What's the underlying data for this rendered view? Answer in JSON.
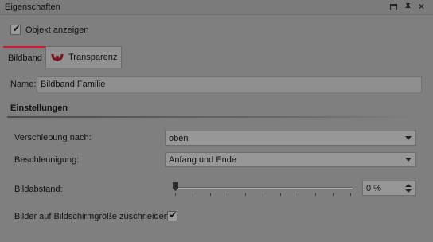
{
  "panel": {
    "title": "Eigenschaften",
    "restore_icon": "restore-window-icon",
    "pin_icon": "pin-icon",
    "close_icon": "close-icon"
  },
  "show_object": {
    "label": "Objekt anzeigen",
    "checked": true
  },
  "tabs": [
    {
      "label": "Bildband",
      "active": true
    },
    {
      "label": "Transparenz",
      "active": false,
      "icon": "transparency-icon"
    }
  ],
  "name": {
    "label": "Name:",
    "value": "Bildband Familie"
  },
  "settings": {
    "title": "Einstellungen",
    "shift": {
      "label": "Verschiebung nach:",
      "value": "oben"
    },
    "acceleration": {
      "label": "Beschleunigung:",
      "value": "Anfang und Ende"
    },
    "spacing": {
      "label": "Bildabstand:",
      "value": "0 %",
      "level": 0
    },
    "crop": {
      "label": "Bilder auf Bildschirmgröße zuschneiden",
      "checked": true
    }
  },
  "colors": {
    "accent": "#c8202e",
    "background": "#7f7f7f"
  }
}
